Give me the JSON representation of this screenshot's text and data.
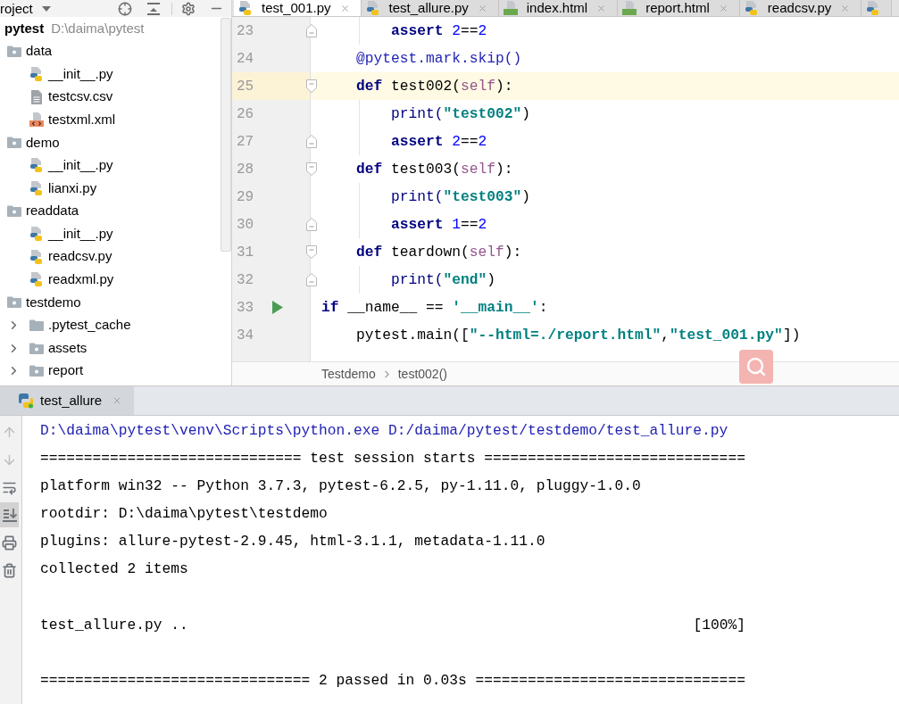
{
  "project_panel": {
    "title": "roject",
    "tree": [
      {
        "kind": "root",
        "name": "pytest",
        "path": "D:\\daima\\pytest",
        "children": [
          {
            "kind": "package",
            "name": "data",
            "expanded": true,
            "children": [
              {
                "kind": "python",
                "name": "__init__.py"
              },
              {
                "kind": "text",
                "name": "testcsv.csv"
              },
              {
                "kind": "xml",
                "name": "testxml.xml"
              }
            ]
          },
          {
            "kind": "package",
            "name": "demo",
            "expanded": true,
            "children": [
              {
                "kind": "python",
                "name": "__init__.py"
              },
              {
                "kind": "python",
                "name": "lianxi.py"
              }
            ]
          },
          {
            "kind": "package",
            "name": "readdata",
            "expanded": true,
            "children": [
              {
                "kind": "python",
                "name": "__init__.py"
              },
              {
                "kind": "python",
                "name": "readcsv.py"
              },
              {
                "kind": "python",
                "name": "readxml.py"
              }
            ]
          },
          {
            "kind": "package",
            "name": "testdemo",
            "expanded": true,
            "children": [
              {
                "kind": "folder",
                "name": ".pytest_cache",
                "expanded": false
              },
              {
                "kind": "package",
                "name": "assets",
                "expanded": false
              },
              {
                "kind": "package",
                "name": "report",
                "expanded": false
              }
            ]
          }
        ]
      }
    ]
  },
  "editor": {
    "tabs": [
      {
        "kind": "python",
        "label": "test_001.py",
        "selected": true
      },
      {
        "kind": "python",
        "label": "test_allure.py",
        "selected": false
      },
      {
        "kind": "html",
        "label": "index.html",
        "selected": false
      },
      {
        "kind": "html",
        "label": "report.html",
        "selected": false
      },
      {
        "kind": "python",
        "label": "readcsv.py",
        "selected": false
      },
      {
        "kind": "python",
        "selected": false
      }
    ],
    "code": [
      {
        "kind": "block",
        "children": [
          {
            "kind": "block",
            "children": [
              {
                "kind": "fold_end",
                "number": "23",
                "current": false,
                "tokens": [
                  {
                    "kind": "keyword",
                    "text": "assert "
                  },
                  {
                    "kind": "number",
                    "text": "2"
                  },
                  {
                    "kind": "plain",
                    "text": "=="
                  },
                  {
                    "kind": "number",
                    "text": "2"
                  }
                ]
              }
            ]
          },
          {
            "kind": "plain",
            "number": "24",
            "current": false,
            "tokens": [
              {
                "kind": "decorator",
                "text": "@pytest.mark.skip()"
              }
            ]
          },
          {
            "kind": "fold_start",
            "number": "25",
            "current": true,
            "tokens": [
              {
                "kind": "keyword",
                "text": "def "
              },
              {
                "kind": "plain",
                "text": "test002("
              },
              {
                "kind": "self",
                "text": "self"
              },
              {
                "kind": "plain",
                "text": "):"
              }
            ],
            "children": [
              {
                "kind": "plain",
                "number": "26",
                "current": false,
                "tokens": [
                  {
                    "kind": "builtin",
                    "text": "print("
                  },
                  {
                    "kind": "string",
                    "text": "\"test002\""
                  },
                  {
                    "kind": "plain",
                    "text": ")"
                  }
                ]
              },
              {
                "kind": "fold_end",
                "number": "27",
                "current": false,
                "tokens": [
                  {
                    "kind": "keyword",
                    "text": "assert "
                  },
                  {
                    "kind": "number",
                    "text": "2"
                  },
                  {
                    "kind": "plain",
                    "text": "=="
                  },
                  {
                    "kind": "number",
                    "text": "2"
                  }
                ]
              }
            ]
          },
          {
            "kind": "fold_start",
            "number": "28",
            "current": false,
            "tokens": [
              {
                "kind": "keyword",
                "text": "def "
              },
              {
                "kind": "plain",
                "text": "test003("
              },
              {
                "kind": "self",
                "text": "self"
              },
              {
                "kind": "plain",
                "text": "):"
              }
            ],
            "children": [
              {
                "kind": "plain",
                "number": "29",
                "current": false,
                "tokens": [
                  {
                    "kind": "builtin",
                    "text": "print("
                  },
                  {
                    "kind": "string",
                    "text": "\"test003\""
                  },
                  {
                    "kind": "plain",
                    "text": ")"
                  }
                ]
              },
              {
                "kind": "fold_end",
                "number": "30",
                "current": false,
                "tokens": [
                  {
                    "kind": "keyword",
                    "text": "assert "
                  },
                  {
                    "kind": "number",
                    "text": "1"
                  },
                  {
                    "kind": "plain",
                    "text": "=="
                  },
                  {
                    "kind": "number",
                    "text": "2"
                  }
                ]
              }
            ]
          },
          {
            "kind": "fold_start",
            "number": "31",
            "current": false,
            "tokens": [
              {
                "kind": "keyword",
                "text": "def "
              },
              {
                "kind": "plain",
                "text": "teardown("
              },
              {
                "kind": "self",
                "text": "self"
              },
              {
                "kind": "plain",
                "text": "):"
              }
            ],
            "children": [
              {
                "kind": "fold_end",
                "number": "32",
                "current": false,
                "tokens": [
                  {
                    "kind": "builtin",
                    "text": "print("
                  },
                  {
                    "kind": "string",
                    "text": "\"end\""
                  },
                  {
                    "kind": "plain",
                    "text": ")"
                  }
                ]
              }
            ]
          }
        ]
      },
      {
        "kind": "run",
        "number": "33",
        "current": false,
        "tokens": [
          {
            "kind": "keyword",
            "text": "if "
          },
          {
            "kind": "plain",
            "text": "__name__ == "
          },
          {
            "kind": "string",
            "text": "'__main__'"
          },
          {
            "kind": "plain",
            "text": ":"
          }
        ],
        "children": [
          {
            "kind": "plain",
            "number": "34",
            "current": false,
            "tokens": [
              {
                "kind": "plain",
                "text": "pytest.main(["
              },
              {
                "kind": "string",
                "text": "\"--html=./report.html\""
              },
              {
                "kind": "plain",
                "text": ","
              },
              {
                "kind": "string",
                "text": "\"test_001.py\""
              },
              {
                "kind": "plain",
                "text": "])"
              }
            ]
          }
        ]
      }
    ],
    "breadcrumb": [
      "Testdemo",
      "test002()"
    ]
  },
  "run_panel": {
    "tab": {
      "label": "test_allure",
      "selected": true
    },
    "toolbar": [
      {
        "kind": "up",
        "disabled": true,
        "selected": false
      },
      {
        "kind": "down",
        "disabled": true,
        "selected": false
      },
      {
        "kind": "wrap",
        "disabled": false,
        "selected": false
      },
      {
        "kind": "scroll_end",
        "disabled": false,
        "selected": true
      },
      {
        "kind": "print",
        "disabled": false,
        "selected": false
      },
      {
        "kind": "clear",
        "disabled": false,
        "selected": false
      }
    ],
    "console": [
      {
        "kind": "command",
        "text": "D:\\daima\\pytest\\venv\\Scripts\\python.exe D:/daima/pytest/testdemo/test_allure.py"
      },
      {
        "kind": "output",
        "text": "============================== test session starts =============================="
      },
      {
        "kind": "output",
        "text": "platform win32 -- Python 3.7.3, pytest-6.2.5, py-1.11.0, pluggy-1.0.0"
      },
      {
        "kind": "output",
        "text": "rootdir: D:\\daima\\pytest\\testdemo"
      },
      {
        "kind": "output",
        "text": "plugins: allure-pytest-2.9.45, html-3.1.1, metadata-1.11.0"
      },
      {
        "kind": "output",
        "text": "collected 2 items"
      },
      {
        "kind": "blank"
      },
      {
        "kind": "progress",
        "text": "test_allure.py ..",
        "percent": "[100%]"
      },
      {
        "kind": "blank"
      },
      {
        "kind": "output",
        "text": "=============================== 2 passed in 0.03s ==============================="
      }
    ]
  }
}
